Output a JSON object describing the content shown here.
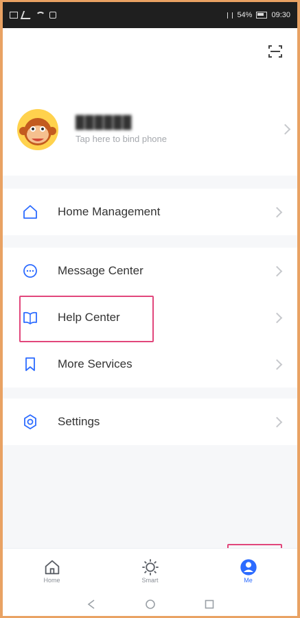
{
  "status_bar": {
    "left_text": "",
    "battery": "54%",
    "time": "09:30"
  },
  "profile": {
    "username": "██████",
    "bind_text": "Tap here to bind phone"
  },
  "menu_groups": [
    {
      "items": [
        {
          "label": "Home Management",
          "icon": "home-icon"
        }
      ]
    },
    {
      "items": [
        {
          "label": "Message Center",
          "icon": "message-icon"
        },
        {
          "label": "Help Center",
          "icon": "book-icon"
        },
        {
          "label": "More Services",
          "icon": "bookmark-icon"
        }
      ]
    },
    {
      "items": [
        {
          "label": "Settings",
          "icon": "settings-icon"
        }
      ]
    }
  ],
  "bottom_tabs": [
    {
      "label": "Home",
      "icon": "home-icon"
    },
    {
      "label": "Smart",
      "icon": "sun-icon"
    },
    {
      "label": "Me",
      "icon": "profile-icon",
      "active": true
    }
  ],
  "colors": {
    "accent": "#2c6bff",
    "highlight_box": "#e1467b",
    "frame": "#e9a263"
  }
}
